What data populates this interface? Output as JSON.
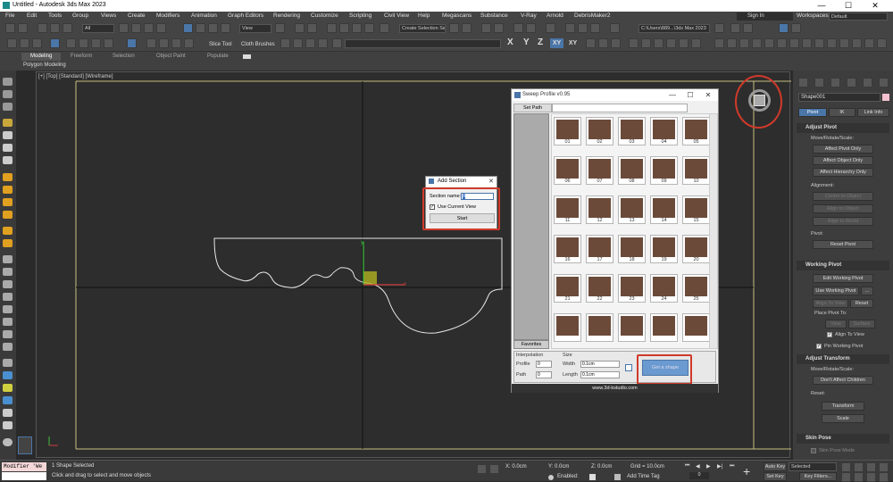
{
  "window": {
    "title": "Untitled - Autodesk 3ds Max 2023",
    "minimize": "—",
    "maximize": "☐",
    "close": "✕"
  },
  "menu": [
    "File",
    "Edit",
    "Tools",
    "Group",
    "Views",
    "Create",
    "Modifiers",
    "Animation",
    "Graph Editors",
    "Rendering",
    "Customize",
    "Scripting",
    "Civil View",
    "Help",
    "Megascans",
    "Substance",
    "V-Ray",
    "Arnold",
    "DebrisMaker2"
  ],
  "signin": "Sign In",
  "workspaces_label": "Workspaces:",
  "workspace": "Default",
  "toolbar": {
    "filter": "All",
    "view": "View",
    "selection_set": "Create Selection Se",
    "slice_tool": "Slice Tool",
    "cloth_brushes": "Cloth Brushes",
    "path": "C:\\Users\\889...\\3ds Max 2023",
    "axes": [
      "X",
      "Y",
      "Z",
      "XY",
      "XY"
    ]
  },
  "ribbon": {
    "tabs": [
      "Modeling",
      "Freeform",
      "Selection",
      "Object Paint",
      "Populate"
    ],
    "sub": "Polygon Modeling"
  },
  "viewport": {
    "label": "[+] [Top] [Standard] [Wireframe]"
  },
  "command_panel": {
    "object_name": "Shape001",
    "tabs": [
      "Pivot",
      "IK",
      "Link Info"
    ],
    "adjust_pivot": {
      "title": "Adjust Pivot",
      "group": "Move/Rotate/Scale:",
      "buttons": [
        "Affect Pivot Only",
        "Affect Object Only",
        "Affect Hierarchy Only"
      ],
      "alignment": "Alignment:",
      "align_buttons": [
        "Center to Object",
        "Align to Object",
        "Align to World"
      ],
      "pivot": "Pivot:",
      "reset": "Reset Pivot"
    },
    "working_pivot": {
      "title": "Working Pivot",
      "edit": "Edit Working Pivot",
      "use": "Use Working Pivot",
      "more": "...",
      "align_view": "Align To View",
      "reset": "Reset",
      "place": "Place Pivot To:",
      "view": "View",
      "surface": "Surface",
      "align_to_view": "Align To View",
      "pin": "Pin Working Pivot"
    },
    "adjust_transform": {
      "title": "Adjust Transform",
      "group": "Move/Rotate/Scale:",
      "dont_affect": "Don't Affect Children",
      "reset": "Reset:",
      "transform": "Transform",
      "scale": "Scale"
    },
    "skin_pose": {
      "title": "Skin Pose",
      "mode": "Skin Pose Mode"
    }
  },
  "sweep_profile": {
    "title": "Sweep Profile v0.95",
    "set_path": "Set Path",
    "favorites": "Favorites",
    "items": [
      "01",
      "02",
      "03",
      "04",
      "05",
      "06",
      "07",
      "08",
      "09",
      "10",
      "11",
      "12",
      "13",
      "14",
      "15",
      "16",
      "17",
      "18",
      "19",
      "20",
      "21",
      "22",
      "23",
      "24",
      "25"
    ],
    "interpolation": "Interpolation",
    "profile_label": "Profile",
    "profile_value": "0",
    "path_label": "Path",
    "path_value": "0",
    "size": "Size",
    "width_label": "Width",
    "width_value": "0.1cm",
    "length_label": "Length",
    "length_value": "0.1cm",
    "get_shape": "Get a shape",
    "website": "www.3d-kstudio.com"
  },
  "add_section": {
    "title": "Add Section",
    "name_label": "Section name:",
    "name_value": "X",
    "use_view": "Use Current View",
    "start": "Start"
  },
  "status": {
    "modifier": "Modifier 'We",
    "selected": "1 Shape Selected",
    "hint": "Click and drag to select and move objects",
    "x": "X: 0.0cm",
    "y": "Y: 0.0cm",
    "z": "Z: 0.0cm",
    "grid": "Grid = 10.0cm",
    "enabled": "Enabled:",
    "add_time_tag": "Add Time Tag",
    "auto_key": "Auto Key",
    "selected_dd": "Selected",
    "set_key": "Set Key",
    "key_filters": "Key Filters...",
    "frame": "0"
  },
  "colors": {
    "accent": "#4a76a8",
    "highlight": "#d03a2a",
    "profile_bg": "#6b4a3a"
  }
}
